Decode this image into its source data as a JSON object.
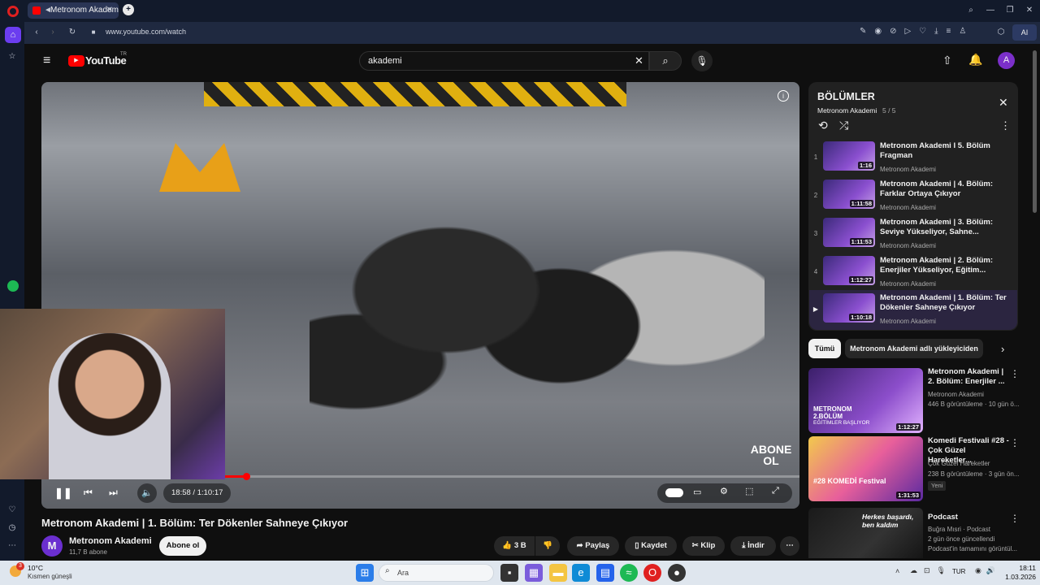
{
  "browser": {
    "tab_title": "Metronom Akademi |",
    "url": "www.youtube.com/watch",
    "ai_label": "AI"
  },
  "search": {
    "query": "akademi"
  },
  "youtube": {
    "logo": "YouTube",
    "region": "TR",
    "avatar": "A"
  },
  "player": {
    "time": "18:58 / 1:10:17",
    "progress": 0.27,
    "overlay": "ABONE OL"
  },
  "video": {
    "title": "Metronom Akademi | 1. Bölüm: Ter Dökenler Sahneye Çıkıyor",
    "channel": "Metronom Akademi",
    "subscribers": "11,7 B abone",
    "subscribe": "Abone ol",
    "likes": "3 B",
    "share": "Paylaş",
    "save": "Kaydet",
    "clip": "Klip",
    "download": "İndir"
  },
  "playlist": {
    "title": "BÖLÜMLER",
    "channel": "Metronom Akademi",
    "count": "5 / 5",
    "items": [
      {
        "n": "1",
        "title": "Metronom Akademi I 5. Bölüm Fragman",
        "channel": "Metronom Akademi",
        "dur": "1:16"
      },
      {
        "n": "2",
        "title": "Metronom Akademi | 4. Bölüm: Farklar Ortaya Çıkıyor",
        "channel": "Metronom Akademi",
        "dur": "1:11:58"
      },
      {
        "n": "3",
        "title": "Metronom Akademi | 3. Bölüm: Seviye Yükseliyor, Sahne...",
        "channel": "Metronom Akademi",
        "dur": "1:11:53"
      },
      {
        "n": "4",
        "title": "Metronom Akademi | 2. Bölüm: Enerjiler Yükseliyor, Eğitim...",
        "channel": "Metronom Akademi",
        "dur": "1:12:27"
      },
      {
        "n": "▶",
        "title": "Metronom Akademi | 1. Bölüm: Ter Dökenler Sahneye Çıkıyor",
        "channel": "Metronom Akademi",
        "dur": "1:10:18"
      }
    ]
  },
  "chips": [
    "Tümü",
    "Metronom Akademi adlı yükleyiciden"
  ],
  "recs": [
    {
      "title": "Metronom Akademi | 2. Bölüm: Enerjiler ...",
      "channel": "Metronom Akademi",
      "meta": "446 B görüntüleme · 10 gün ö...",
      "dur": "1:12:27",
      "badge": "",
      "thumb_text": "METRONOM 2.BÖLÜM",
      "thumb_sub": "EĞİTİMLER BAŞLIYOR"
    },
    {
      "title": "Komedi Festivali #28 - Çok Güzel Hareketler...",
      "channel": "Çok Güzel Hareketler",
      "meta": "238 B görüntüleme · 3 gün ön...",
      "dur": "1:31:53",
      "badge": "Yeni",
      "thumb_text": "#28 KOMEDİ Festival",
      "thumb_sub": ""
    },
    {
      "title": "Podcast",
      "channel": "Buğra Mısri · Podcast",
      "meta": "2 gün önce güncellendi",
      "extra": "Podcast'in tamamını görüntül...",
      "dur": "",
      "badge": "",
      "thumb_text": "Herkes başardı, ben kaldım",
      "thumb_sub": ""
    }
  ],
  "taskbar": {
    "weather_temp": "10°C",
    "weather_desc": "Kısmen güneşli",
    "weather_badge": "3",
    "search": "Ara",
    "lang": "TUR",
    "time": "18:11",
    "date": "1.03.2026"
  },
  "colors": {
    "accent": "#ff0000",
    "playlist_bg": "#212121",
    "avatar": "#7b2fc9"
  }
}
